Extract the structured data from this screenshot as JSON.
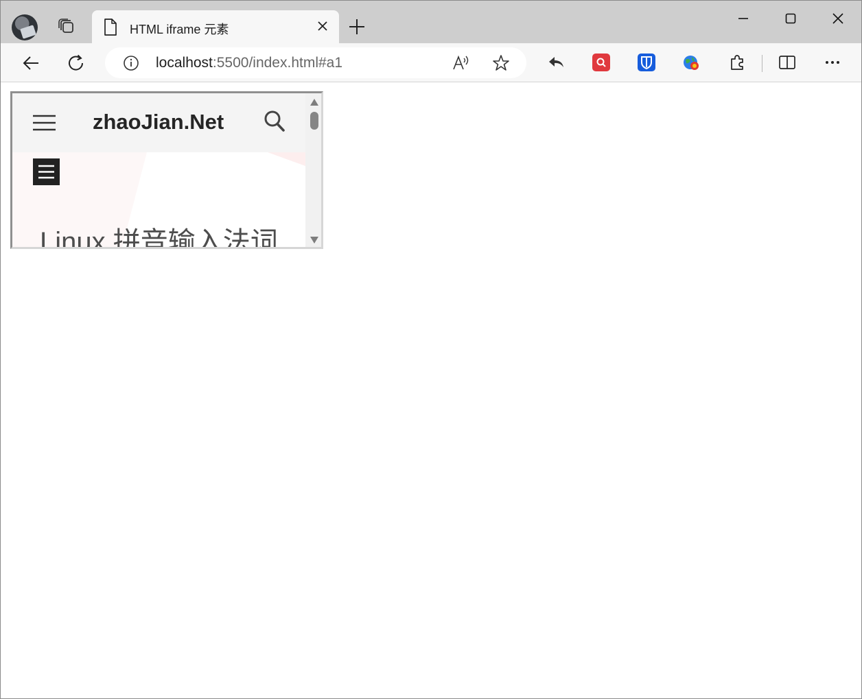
{
  "browser": {
    "tab": {
      "title": "HTML iframe 元素",
      "icon": "document-icon"
    },
    "address": {
      "host": "localhost",
      "rest": ":5500/index.html#a1",
      "info_icon": "info-icon"
    },
    "extensions": [
      "reply-icon",
      "red-search-extension-icon",
      "bitwarden-shield-icon",
      "globe-extension-icon",
      "puzzle-extensions-icon"
    ],
    "colors": {
      "titlebar": "#cecece",
      "toolbar": "#f7f7f7",
      "tab": "#f7f7f7"
    }
  },
  "iframe": {
    "site_title": "zhaoJian.Net",
    "article_title": "Linux 拼音输入法词",
    "colors": {
      "header_bg": "#f4f4f4",
      "menu_button": "#222222",
      "title_text": "#4d4d4d"
    }
  }
}
